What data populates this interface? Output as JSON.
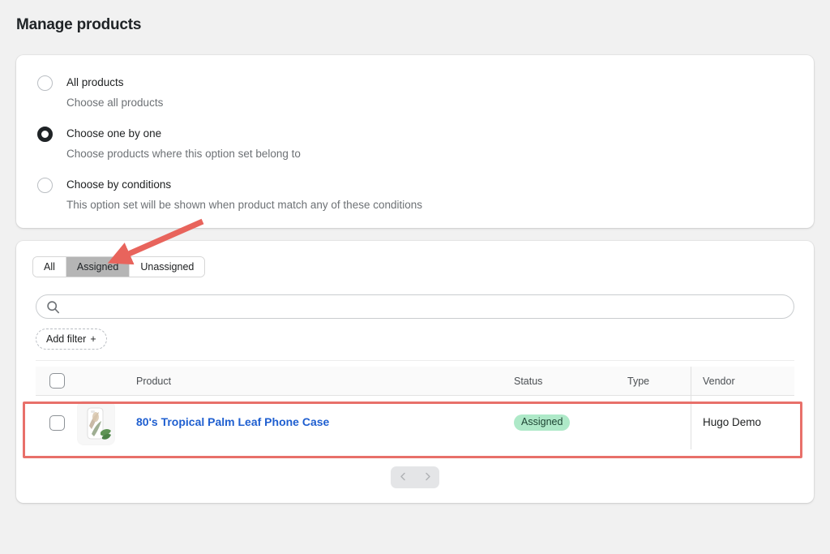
{
  "page": {
    "title": "Manage products",
    "background_color": "#f1f1f1"
  },
  "options_card": {
    "options": [
      {
        "label": "All products",
        "description": "Choose all products",
        "selected": false
      },
      {
        "label": "Choose one by one",
        "description": "Choose products where this option set belong to",
        "selected": true
      },
      {
        "label": "Choose by conditions",
        "description": "This option set will be shown when product match any of these conditions",
        "selected": false
      }
    ]
  },
  "products_card": {
    "tabs": [
      {
        "label": "All",
        "active": false
      },
      {
        "label": "Assigned",
        "active": true
      },
      {
        "label": "Unassigned",
        "active": false
      }
    ],
    "search": {
      "value": "",
      "placeholder": "",
      "icon": "search-icon"
    },
    "add_filter": {
      "label": "Add filter",
      "plus": "+"
    },
    "table": {
      "columns": [
        "",
        "",
        "Product",
        "Status",
        "Type",
        "Vendor"
      ],
      "headers": {
        "product": "Product",
        "status": "Status",
        "type": "Type",
        "vendor": "Vendor"
      },
      "rows": [
        {
          "selected": false,
          "thumbnail": "tropical-palm-leaf-phone-case-thumbnail",
          "product": "80's Tropical Palm Leaf Phone Case",
          "status": "Assigned",
          "status_color": "#aee9c8",
          "type": "",
          "vendor": "Hugo Demo"
        }
      ]
    },
    "pagination": {
      "previous_icon": "chevron-left-icon",
      "next_icon": "chevron-right-icon",
      "previous_enabled": false,
      "next_enabled": false
    }
  },
  "annotations": {
    "arrow_color": "#e8645c",
    "highlight_color": "#e8706a"
  }
}
